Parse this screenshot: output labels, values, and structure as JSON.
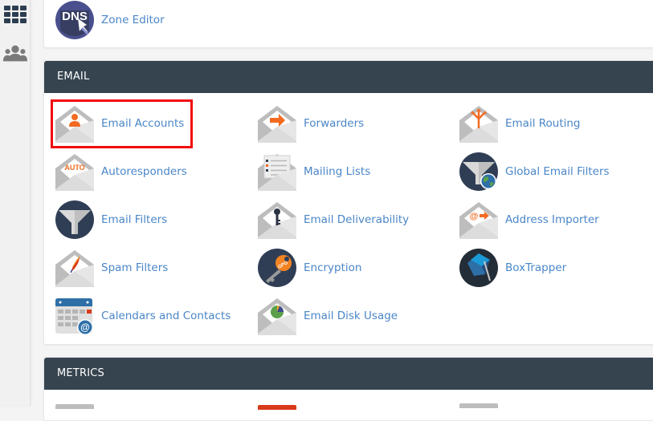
{
  "sidebar": {
    "items": [
      {
        "icon": "grid-icon",
        "label": ""
      },
      {
        "icon": "users-icon",
        "label": ""
      }
    ]
  },
  "domains_section": {
    "items": [
      {
        "label": "Zone Editor",
        "icon": "dns-icon"
      }
    ]
  },
  "email_section": {
    "title": "EMAIL",
    "highlighted_item": "Email Accounts",
    "highlight_color": "#f20a0a",
    "items": [
      {
        "label": "Email Accounts",
        "icon": "email-accounts-icon"
      },
      {
        "label": "Forwarders",
        "icon": "forwarders-icon"
      },
      {
        "label": "Email Routing",
        "icon": "email-routing-icon"
      },
      {
        "label": "Autoresponders",
        "icon": "autoresponders-icon",
        "badge": "AUTO"
      },
      {
        "label": "Mailing Lists",
        "icon": "mailing-lists-icon"
      },
      {
        "label": "Global Email Filters",
        "icon": "global-email-filters-icon"
      },
      {
        "label": "Email Filters",
        "icon": "email-filters-icon"
      },
      {
        "label": "Email Deliverability",
        "icon": "email-deliverability-icon"
      },
      {
        "label": "Address Importer",
        "icon": "address-importer-icon"
      },
      {
        "label": "Spam Filters",
        "icon": "spam-filters-icon"
      },
      {
        "label": "Encryption",
        "icon": "encryption-icon",
        "badge": "GPG"
      },
      {
        "label": "BoxTrapper",
        "icon": "boxtrapper-icon"
      },
      {
        "label": "Calendars and Contacts",
        "icon": "calendars-contacts-icon"
      },
      {
        "label": "Email Disk Usage",
        "icon": "email-disk-usage-icon"
      }
    ]
  },
  "metrics_section": {
    "title": "METRICS"
  },
  "colors": {
    "header_bg": "#36444f",
    "link": "#4a86c7",
    "accent_orange": "#f26b21",
    "icon_dark": "#2f3e55"
  }
}
